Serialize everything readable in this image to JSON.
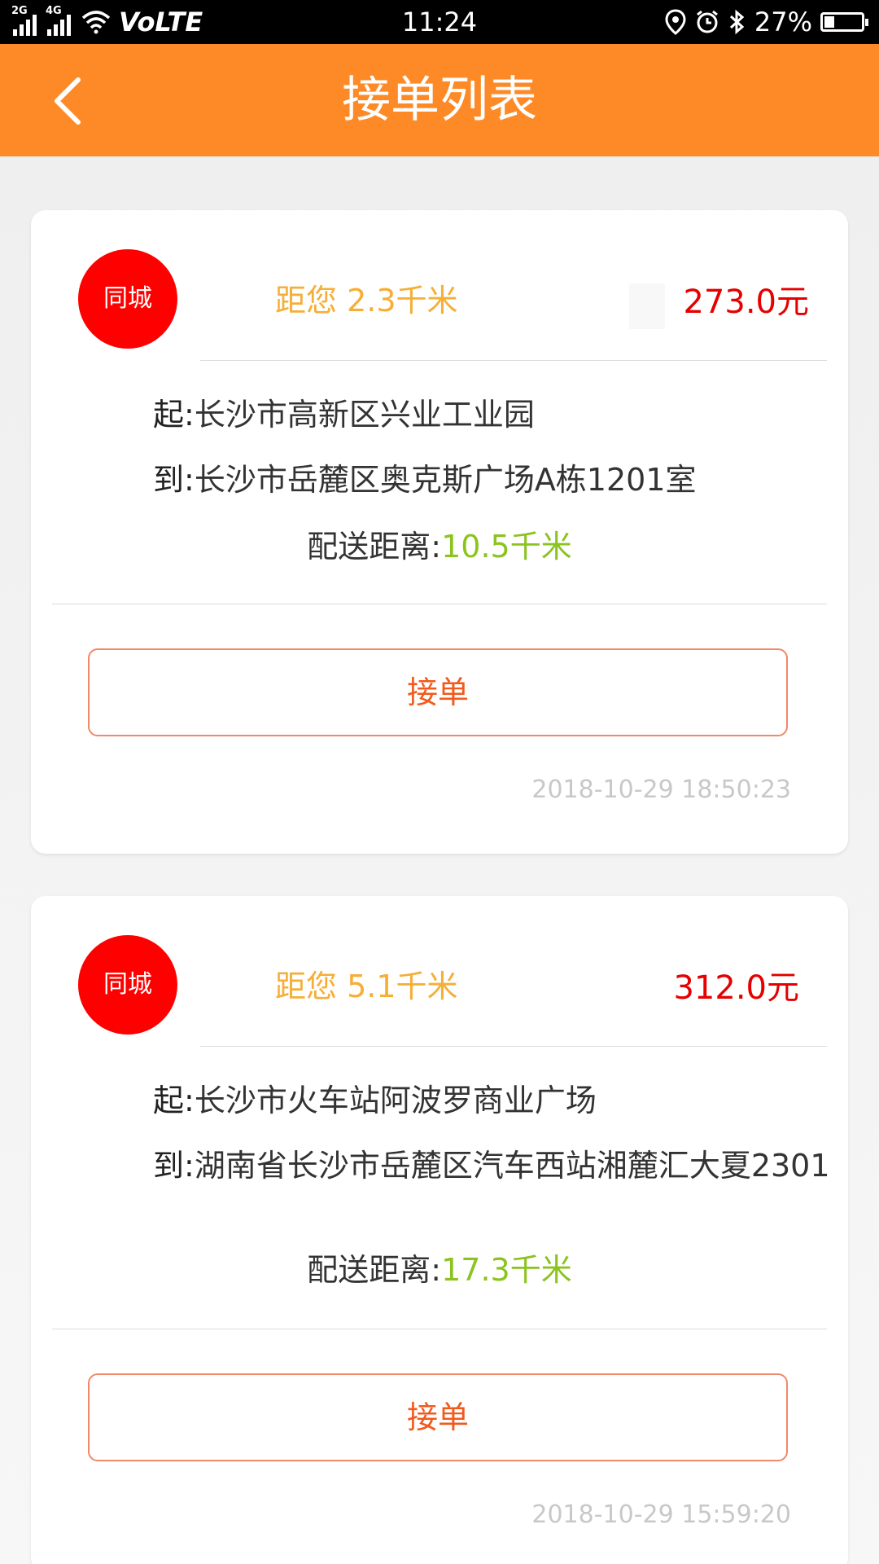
{
  "status_bar": {
    "network_left": "2G",
    "network_right": "4G",
    "carrier_label": "VoLTE",
    "time": "11:24",
    "battery": "27%",
    "battery_level": 0.27
  },
  "header": {
    "title": "接单列表",
    "background": "#fd8a26"
  },
  "orders": [
    {
      "badge": "同城",
      "distance_to_you": "距您 2.3千米",
      "price": "273.0元",
      "from_key": "起:",
      "from": "长沙市高新区兴业工业园",
      "to_key": "到:",
      "to": "长沙市岳麓区奥克斯广场A栋1201室",
      "delivery_key": "配送距离:",
      "delivery_value": "10.5千米",
      "accept_label": "接单",
      "timestamp": "2018-10-29 18:50:23"
    },
    {
      "badge": "同城",
      "distance_to_you": "距您 5.1千米",
      "price": "312.0元",
      "from_key": "起:",
      "from": "长沙市火车站阿波罗商业广场",
      "to_key": "到:",
      "to": "湖南省长沙市岳麓区汽车西站湘麓汇大夏2301",
      "delivery_key": "配送距离:",
      "delivery_value": "17.3千米",
      "accept_label": "接单",
      "timestamp": "2018-10-29 15:59:20"
    }
  ],
  "colors": {
    "badge": "#ff0000",
    "distance_to_you": "#f6ae36",
    "price": "#e60000",
    "delivery_value": "#8bc31f",
    "accept_button": "#f25a1c"
  }
}
